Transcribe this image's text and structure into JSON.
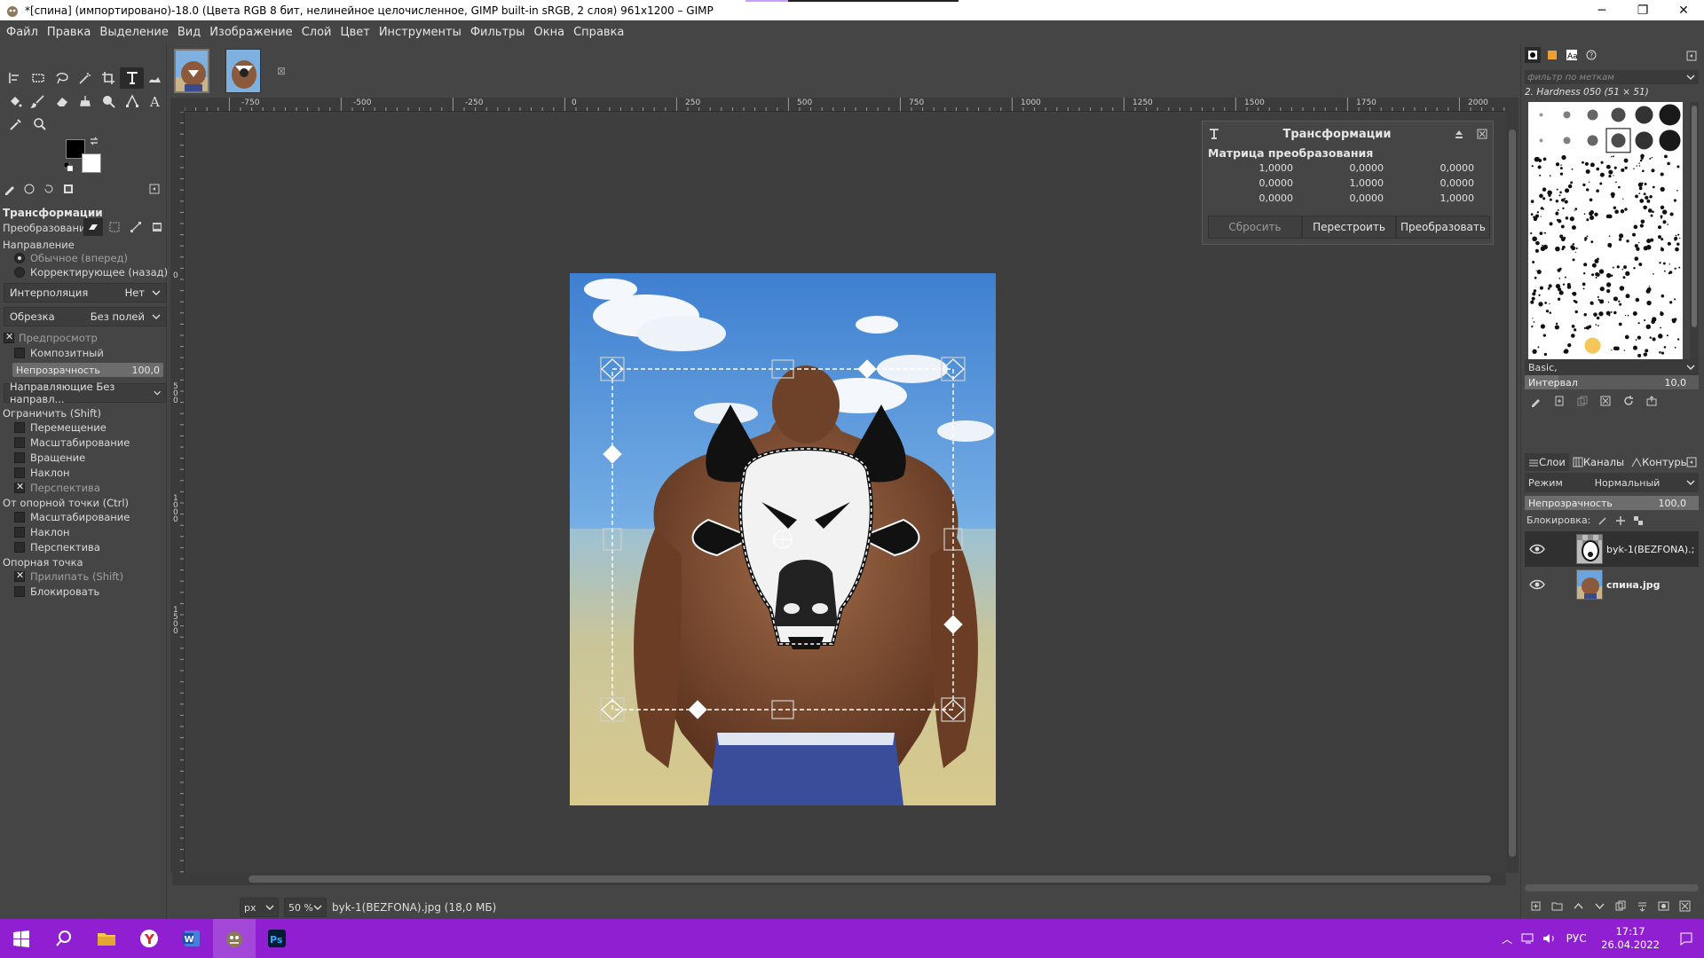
{
  "window": {
    "title": "*[спина] (импортировано)-18.0 (Цвета RGB 8 бит, нелинейное целочисленное, GIMP built-in sRGB, 2 слоя) 961x1200 – GIMP",
    "minimize": "─",
    "maximize": "❐",
    "close": "✕"
  },
  "menu": [
    "Файл",
    "Правка",
    "Выделение",
    "Вид",
    "Изображение",
    "Слой",
    "Цвет",
    "Инструменты",
    "Фильтры",
    "Окна",
    "Справка"
  ],
  "tool_options": {
    "title": "Трансформации",
    "transform_label": "Преобразование:",
    "direction_label": "Направление",
    "direction_normal": "Обычное (вперед)",
    "direction_corrective": "Корректирующее (назад)",
    "interpolation_label": "Интерполяция",
    "interpolation_value": "Нет",
    "clipping_label": "Обрезка",
    "clipping_value": "Без полей",
    "preview_label": "Предпросмотр",
    "composite_label": "Композитный",
    "opacity_label": "Непрозрачность",
    "opacity_value": "100,0",
    "guides_label": "Направляющие Без направл...",
    "constrain_label": "Ограничить (Shift)",
    "c_move": "Перемещение",
    "c_scale": "Масштабирование",
    "c_rotate": "Вращение",
    "c_shear": "Наклон",
    "c_perspective": "Перспектива",
    "pivot_label": "От опорной точки  (Ctrl)",
    "p_scale": "Масштабирование",
    "p_shear": "Наклон",
    "p_perspective": "Перспектива",
    "anchor_label": "Опорная точка",
    "a_snap": "Прилипать (Shift)",
    "a_lock": "Блокировать"
  },
  "rulers": {
    "top": [
      "-750",
      "-500",
      "-250",
      "0",
      "250",
      "500",
      "750",
      "1000",
      "1250",
      "1500",
      "1750",
      "2000"
    ],
    "left": [
      "0",
      "5 0 0",
      "1 0 0 0",
      "1 5 0 0"
    ]
  },
  "transform_dialog": {
    "title": "Трансформации",
    "matrix_title": "Матрица преобразования",
    "matrix": [
      "1,0000",
      "0,0000",
      "0,0000",
      "0,0000",
      "1,0000",
      "0,0000",
      "0,0000",
      "0,0000",
      "1,0000"
    ],
    "reset": "Сбросить",
    "readjust": "Перестроить",
    "transform": "Преобразовать"
  },
  "statusbar": {
    "unit": "px",
    "zoom": "50 %",
    "info": "byk-1(BEZFONA).jpg (18,0 МБ)"
  },
  "brushes": {
    "filter_placeholder": "фильтр по меткам",
    "current": "2. Hardness 050 (51 × 51)",
    "preset": "Basic,",
    "spacing_label": "Интервал",
    "spacing_value": "10,0"
  },
  "layers": {
    "tabs": [
      "Слои",
      "Каналы",
      "Контуры"
    ],
    "mode_label": "Режим",
    "mode_value": "Нормальный",
    "opacity_label": "Непрозрачность",
    "opacity_value": "100,0",
    "lock_label": "Блокировка:",
    "items": [
      {
        "name": "byk-1(BEZFONA).;",
        "active": true
      },
      {
        "name": "спина.jpg",
        "active": false
      }
    ]
  },
  "taskbar": {
    "lang": "РУС",
    "time": "17:17",
    "date": "26.04.2022",
    "accent": "#8f1fd1"
  }
}
